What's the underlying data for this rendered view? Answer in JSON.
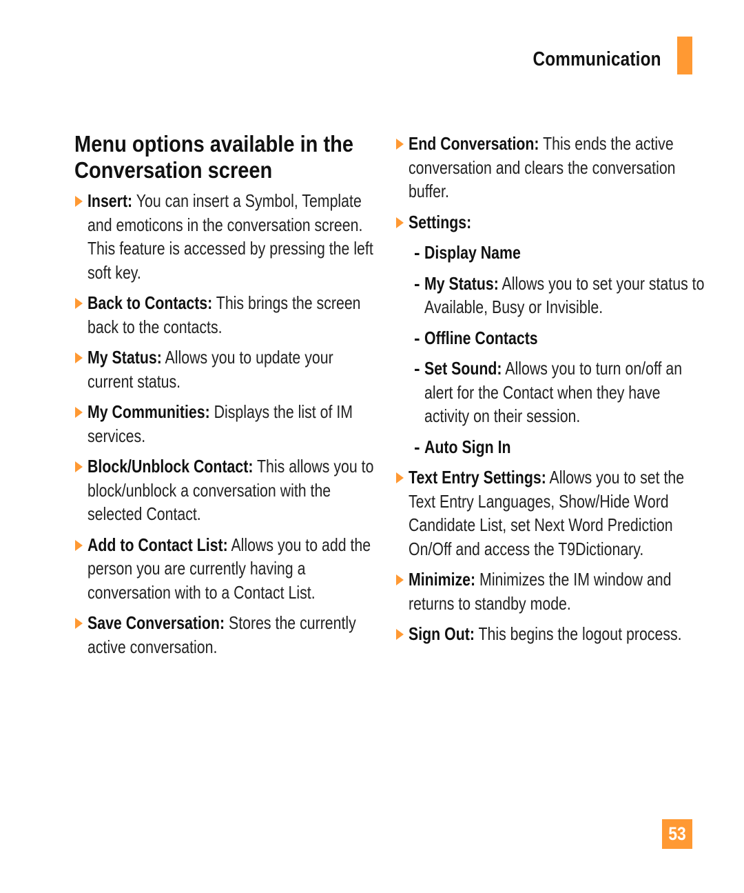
{
  "header": {
    "section_title": "Communication",
    "accent_color": "#ff9933"
  },
  "page": {
    "title": "Menu options available in the Conversation screen",
    "number": "53"
  },
  "left_items": [
    {
      "term": "Insert:",
      "desc": " You can insert a Symbol, Template and emoticons in the conversation screen. This feature is accessed by pressing the left soft key."
    },
    {
      "term": "Back to Contacts:",
      "desc": " This brings the screen back to the contacts."
    },
    {
      "term": "My Status:",
      "desc": " Allows you to update your current status."
    },
    {
      "term": "My Communities:",
      "desc": " Displays the list of IM services."
    },
    {
      "term": "Block/Unblock Contact:",
      "desc": " This allows you to block/unblock a conversation with the selected Contact."
    },
    {
      "term": "Add to Contact List:",
      "desc": " Allows you to add the person you are currently having a conversation with to a Contact List."
    },
    {
      "term": "Save Conversation:",
      "desc": " Stores the currently active conversation."
    }
  ],
  "right_items": {
    "end_conversation": {
      "term": "End Conversation:",
      "desc": " This ends the active conversation and clears the conversation buffer."
    },
    "settings": {
      "term": "Settings:",
      "subitems": [
        {
          "term": "Display Name",
          "desc": ""
        },
        {
          "term": "My Status:",
          "desc": " Allows you to set your status to Available, Busy or Invisible."
        },
        {
          "term": "Offline Contacts",
          "desc": ""
        },
        {
          "term": "Set Sound:",
          "desc": " Allows you to turn on/off an alert for the Contact when they have activity on their session."
        },
        {
          "term": "Auto Sign In",
          "desc": ""
        }
      ]
    },
    "text_entry_settings": {
      "term": "Text Entry Settings:",
      "desc": " Allows you to set the Text Entry Languages, Show/Hide Word Candidate List, set Next Word Prediction On/Off and access the T9Dictionary."
    },
    "minimize": {
      "term": "Minimize:",
      "desc": " Minimizes the IM window and returns to standby mode."
    },
    "sign_out": {
      "term": "Sign Out:",
      "desc": " This begins the logout process."
    }
  },
  "icons": {
    "bullet": "orange-triangle-arrow-icon",
    "sub_bullet": "-"
  }
}
